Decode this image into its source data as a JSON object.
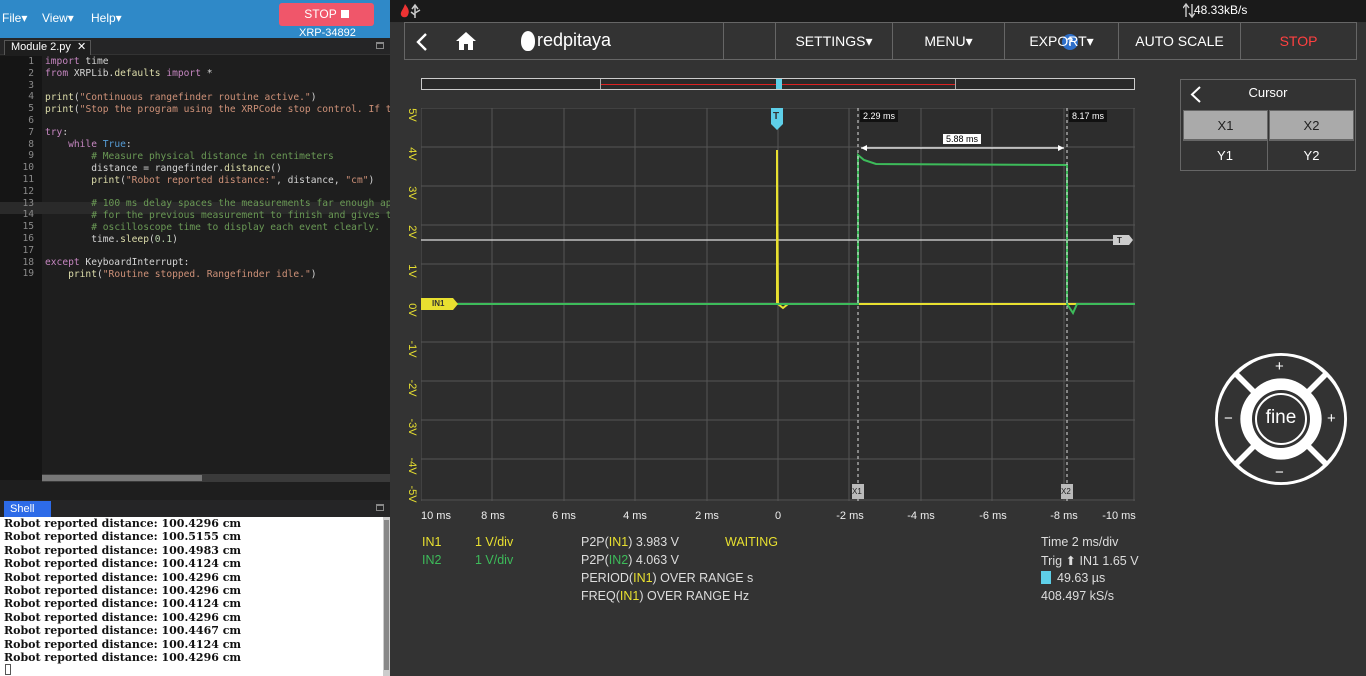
{
  "ide": {
    "menus": [
      "File▾",
      "View▾",
      "Help▾"
    ],
    "stop_label": "STOP",
    "device_id": "XRP-34892",
    "tab_label": "Module 2.py",
    "tab_close": "✕",
    "line_numbers": [
      "1",
      "2",
      "3",
      "4",
      "5",
      "6",
      "7",
      "8",
      "9",
      "10",
      "11",
      "12",
      "13",
      "14",
      "15",
      "16",
      "17",
      "18",
      "19"
    ],
    "shell_label": "Shell",
    "shell_lines": [
      "Robot reported distance: 100.4296 cm",
      "Robot reported distance: 100.5155 cm",
      "Robot reported distance: 100.4983 cm",
      "Robot reported distance: 100.4124 cm",
      "Robot reported distance: 100.4296 cm",
      "Robot reported distance: 100.4296 cm",
      "Robot reported distance: 100.4124 cm",
      "Robot reported distance: 100.4296 cm",
      "Robot reported distance: 100.4467 cm",
      "Robot reported distance: 100.4124 cm",
      "Robot reported distance: 100.4296 cm"
    ]
  },
  "scope": {
    "transfer_rate": "48.33kB/s",
    "brand": "redpitaya",
    "help": "?",
    "nav": [
      "SETTINGS▾",
      "MENU▾",
      "EXPORT▾",
      "AUTO SCALE",
      "STOP"
    ],
    "stop_color": "#ff4040",
    "y_labels": [
      "5V",
      "4V",
      "3V",
      "2V",
      "1V",
      "0V",
      "-1V",
      "-2V",
      "-3V",
      "-4V",
      "-5V"
    ],
    "x_labels": [
      "10 ms",
      "8 ms",
      "6 ms",
      "4 ms",
      "2 ms",
      "0",
      "-2 ms",
      "-4 ms",
      "-6 ms",
      "-8 ms",
      "-10 ms"
    ],
    "marker_T": "T",
    "marker_in1": "IN1",
    "cursor_x1_label": "2.29 ms",
    "cursor_x2_label": "8.17 ms",
    "cursor_delta": "5.88 ms",
    "cursor_x1_tag": "X1",
    "cursor_x2_tag": "X2",
    "trigger_level_tag": "T",
    "meas": {
      "in1": "IN1",
      "in1_div": "1 V/div",
      "in2": "IN2",
      "in2_div": "1 V/div",
      "p2p_prefix": "P2P(",
      "p2p_in1_ch": "IN1",
      "p2p_in1_val": ") 3.983 V",
      "p2p_in2_ch": "IN2",
      "p2p_in2_val": ") 4.063 V",
      "period_prefix": "PERIOD(",
      "period_ch": "IN1",
      "period_val": ") OVER RANGE s",
      "freq_prefix": "FREQ(",
      "freq_ch": "IN1",
      "freq_val": ") OVER RANGE Hz",
      "status": "WAITING",
      "time": "Time 2 ms/div",
      "trig_prefix": "Trig ⬆ ",
      "trig_ch": "IN1",
      "trig_val": " 1.65 V",
      "t_offset": "49.63 µs",
      "sample_rate": "408.497 kS/s"
    },
    "cursor_panel": {
      "title": "Cursor",
      "x1": "X1",
      "x2": "X2",
      "y1": "Y1",
      "y2": "Y2"
    },
    "wheel_label": "fine",
    "wheel_plus": "+",
    "wheel_minus": "−"
  }
}
